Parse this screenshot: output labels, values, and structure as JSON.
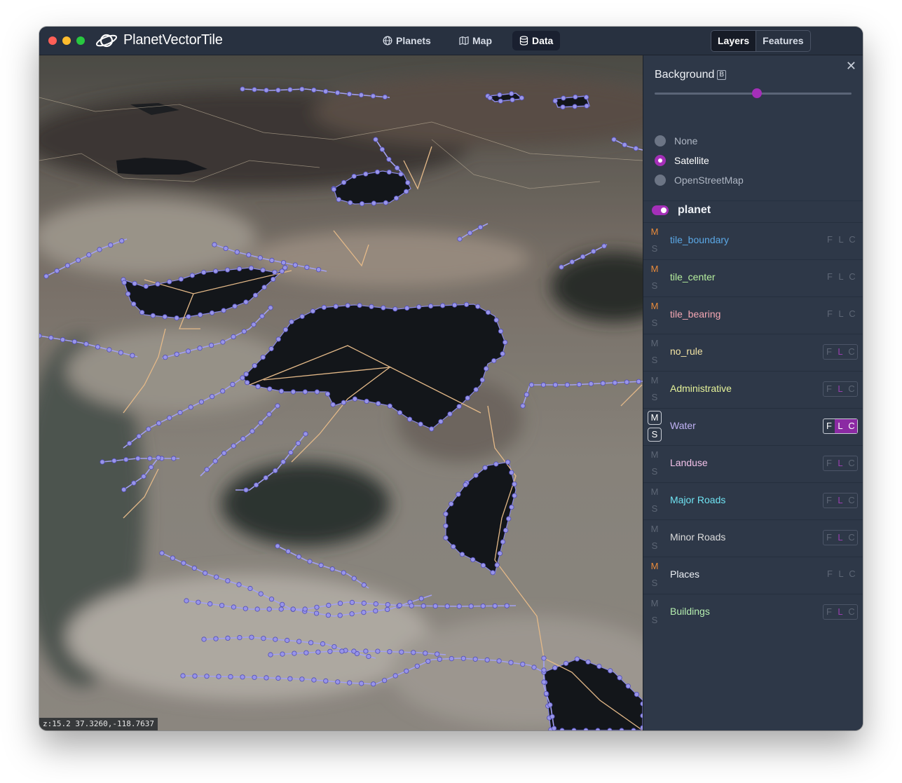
{
  "app": {
    "title": "PlanetVectorTile",
    "nav": [
      {
        "label": "Planets",
        "icon": "globe-icon"
      },
      {
        "label": "Map",
        "icon": "map-icon"
      },
      {
        "label": "Data",
        "icon": "database-icon",
        "active": true
      }
    ],
    "segments": [
      {
        "label": "Layers",
        "active": true
      },
      {
        "label": "Features",
        "active": false
      }
    ]
  },
  "map": {
    "status": "z:15.2 37.3260,-118.7637"
  },
  "panel": {
    "close_glyph": "✕",
    "background_title": "Background",
    "background_shortcut": "B",
    "opacity": 0.52,
    "options": [
      {
        "label": "None",
        "selected": false
      },
      {
        "label": "Satellite",
        "selected": true
      },
      {
        "label": "OpenStreetMap",
        "selected": false
      }
    ],
    "source": {
      "label": "planet",
      "enabled": true
    },
    "layers": [
      {
        "name": "tile_boundary",
        "color": "#5ba8e6",
        "m": "M",
        "s": "S",
        "m_on": true,
        "f": "F",
        "l": "L",
        "c": "C"
      },
      {
        "name": "tile_center",
        "color": "#b6ef9e",
        "m": "M",
        "s": "S",
        "m_on": true,
        "f": "F",
        "l": "L",
        "c": "C"
      },
      {
        "name": "tile_bearing",
        "color": "#f4a7b3",
        "m": "M",
        "s": "S",
        "m_on": true,
        "f": "F",
        "l": "L",
        "c": "C"
      },
      {
        "name": "no_rule",
        "color": "#f3e4a4",
        "m": "M",
        "s": "S",
        "m_on": false,
        "f": "F",
        "l": "L",
        "c": "C",
        "l_on": true,
        "outlined": true
      },
      {
        "name": "Administrative",
        "color": "#e7f49a",
        "m": "M",
        "s": "S",
        "m_on": false,
        "f": "F",
        "l": "L",
        "c": "C",
        "l_on": true,
        "outlined": true
      },
      {
        "name": "Water",
        "color": "#c0b2f4",
        "m": "M",
        "s": "S",
        "m_on": false,
        "boxed": true,
        "f": "F",
        "l": "L",
        "c": "C",
        "l_on": true,
        "c_on": true,
        "strong": true
      },
      {
        "name": "Landuse",
        "color": "#f3c2ea",
        "m": "M",
        "s": "S",
        "m_on": false,
        "f": "F",
        "l": "L",
        "c": "C",
        "l_on": true,
        "outlined": true
      },
      {
        "name": "Major Roads",
        "color": "#6fe3f2",
        "m": "M",
        "s": "S",
        "m_on": false,
        "f": "F",
        "l": "L",
        "c": "C",
        "l_on": true,
        "outlined": true
      },
      {
        "name": "Minor Roads",
        "color": "#dcdcdc",
        "m": "M",
        "s": "S",
        "m_on": false,
        "f": "F",
        "l": "L",
        "c": "C",
        "l_on": true,
        "outlined": true
      },
      {
        "name": "Places",
        "color": "#eef1f6",
        "m": "M",
        "s": "S",
        "m_on": true,
        "f": "F",
        "l": "L",
        "c": "C"
      },
      {
        "name": "Buildings",
        "color": "#b6efb0",
        "m": "M",
        "s": "S",
        "m_on": false,
        "f": "F",
        "l": "L",
        "c": "C",
        "l_on": true,
        "outlined": true
      }
    ]
  },
  "colors": {
    "accent": "#a42fb8",
    "water_line": "#aaa8ff",
    "road_line": "#f1c38e",
    "m_on": "#e88a3a"
  }
}
